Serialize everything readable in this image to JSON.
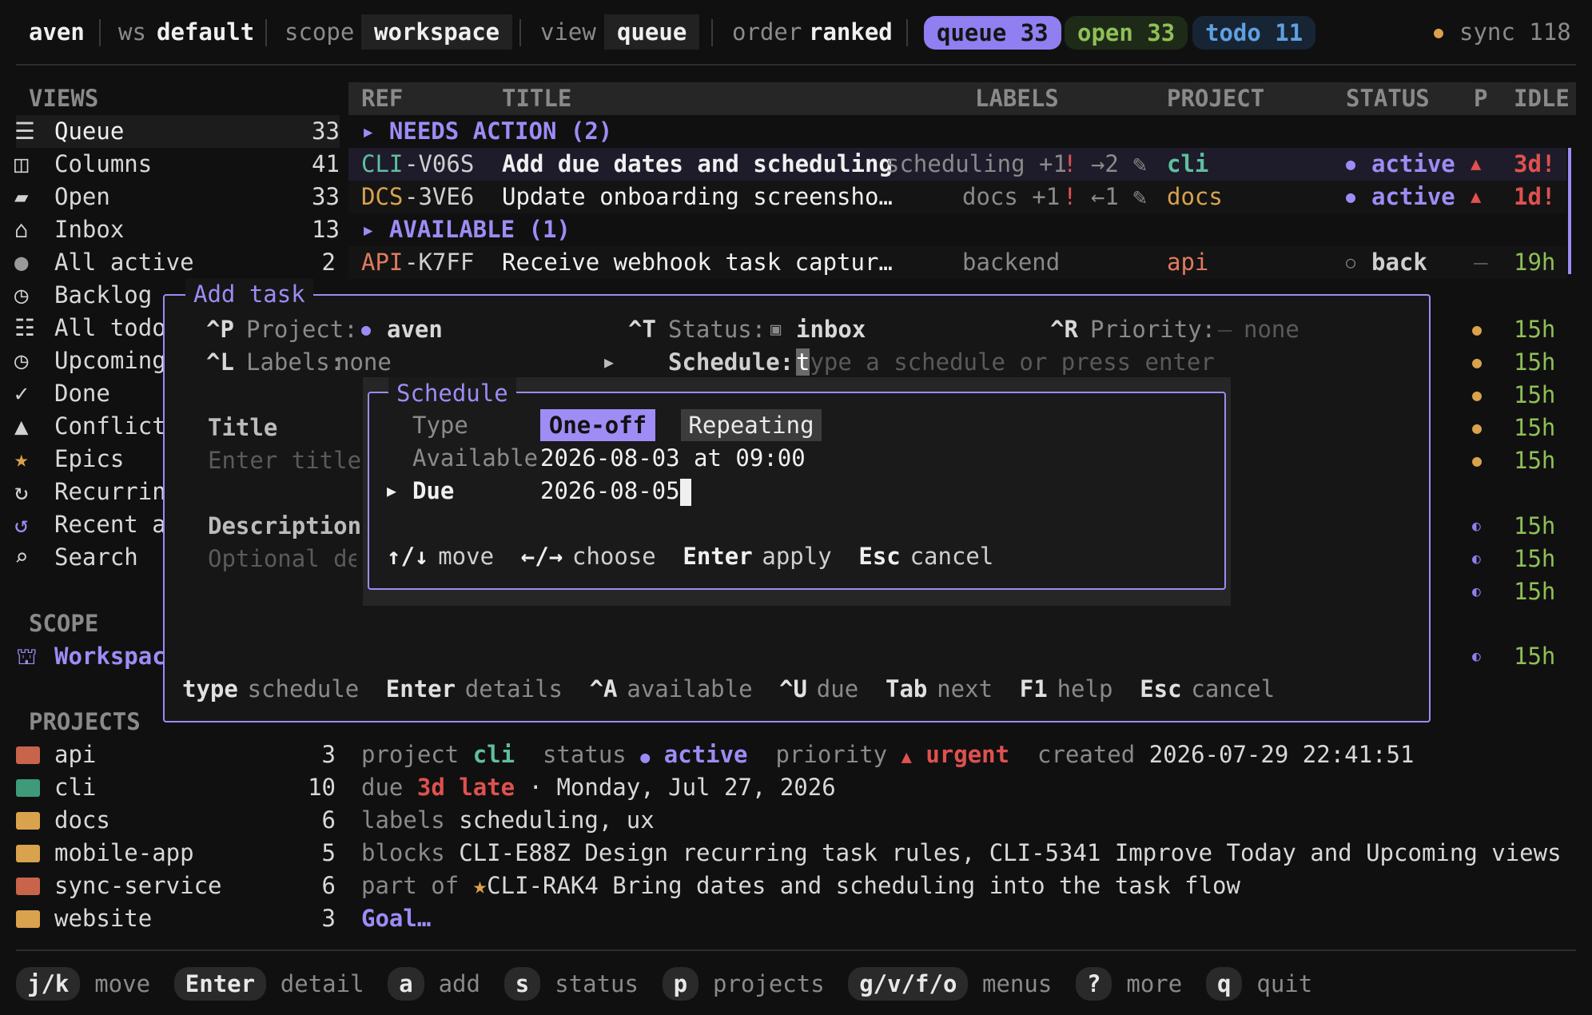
{
  "colors": {
    "accent": "#9d8cf5",
    "green": "#8fbf57",
    "orange": "#d9a24d",
    "red": "#e0514f",
    "teal": "#5fbf9f",
    "blue": "#5fa0e0",
    "salmon": "#e07a5f"
  },
  "topbar": {
    "user": "aven",
    "ws_label": "ws",
    "ws_value": "default",
    "scope_label": "scope",
    "scope_value": "workspace",
    "view_label": "view",
    "view_value": "queue",
    "order_label": "order",
    "order_value": "ranked",
    "queue_pill": "queue 33",
    "open_pill": "open 33",
    "todo_pill": "todo 11",
    "sync": "sync 118"
  },
  "sidebar": {
    "views_header": "VIEWS",
    "views": [
      {
        "icon": "list-icon",
        "label": "Queue",
        "count": "33"
      },
      {
        "icon": "columns-icon",
        "label": "Columns",
        "count": "41"
      },
      {
        "icon": "folder-open-icon",
        "label": "Open",
        "count": "33"
      },
      {
        "icon": "inbox-icon",
        "label": "Inbox",
        "count": "13"
      },
      {
        "icon": "circle-icon",
        "label": "All active",
        "count": "2"
      },
      {
        "icon": "clock-icon",
        "label": "Backlog",
        "count": ""
      },
      {
        "icon": "checklist-icon",
        "label": "All todo",
        "count": ""
      },
      {
        "icon": "clock-icon",
        "label": "Upcoming",
        "count": ""
      },
      {
        "icon": "check-icon",
        "label": "Done",
        "count": ""
      },
      {
        "icon": "warning-icon",
        "label": "Conflict",
        "count": ""
      },
      {
        "icon": "star-icon",
        "label": "Epics",
        "count": ""
      },
      {
        "icon": "repeat-icon",
        "label": "Recurrin",
        "count": ""
      },
      {
        "icon": "history-icon",
        "label": "Recent a",
        "count": ""
      },
      {
        "icon": "search-icon",
        "label": "Search",
        "count": ""
      }
    ],
    "scope_header": "SCOPE",
    "scope_item": "Workspac",
    "projects_header": "PROJECTS",
    "projects": [
      {
        "label": "api",
        "count": "3",
        "color": "#c8644a"
      },
      {
        "label": "cli",
        "count": "10",
        "color": "#3f9a7a"
      },
      {
        "label": "docs",
        "count": "6",
        "color": "#d9a24d"
      },
      {
        "label": "mobile-app",
        "count": "5",
        "color": "#d9a24d"
      },
      {
        "label": "sync-service",
        "count": "6",
        "color": "#c8644a"
      },
      {
        "label": "website",
        "count": "3",
        "color": "#d9a24d"
      }
    ]
  },
  "table": {
    "headers": {
      "ref": "REF",
      "title": "TITLE",
      "labels": "LABELS",
      "project": "PROJECT",
      "status": "STATUS",
      "p": "P",
      "idle": "IDLE"
    },
    "group1": "▸ NEEDS ACTION (2)",
    "group2": "▸ AVAILABLE (1)",
    "rows": [
      {
        "ref_prefix": "CLI",
        "ref_suffix": "-V06S",
        "title": "Add due dates and scheduling",
        "labels": "scheduling +1",
        "flags": "! →2 ✎",
        "project": "cli",
        "status": "active",
        "p": "▲",
        "idle": "3d!"
      },
      {
        "ref_prefix": "DCS",
        "ref_suffix": "-3VE6",
        "title": "Update onboarding screensho…",
        "labels": "docs +1",
        "flags": "! ←1 ✎",
        "project": "docs",
        "status": "active",
        "p": "▲",
        "idle": "1d!"
      },
      {
        "ref_prefix": "API",
        "ref_suffix": "-K7FF",
        "title": "Receive webhook task captur…",
        "labels": "backend",
        "flags": "",
        "project": "api",
        "status": "back",
        "p": "–",
        "idle": "19h"
      }
    ],
    "hidden_rows": [
      {
        "p": "●",
        "idle": "15h"
      },
      {
        "p": "●",
        "idle": "15h"
      },
      {
        "p": "●",
        "idle": "15h"
      },
      {
        "p": "●",
        "idle": "15h"
      },
      {
        "p": "●",
        "idle": "15h"
      },
      {
        "p": "◐",
        "idle": "15h"
      },
      {
        "p": "◐",
        "idle": "15h"
      },
      {
        "p": "◐",
        "idle": "15h"
      },
      {
        "p": "◐",
        "idle": "15h"
      }
    ]
  },
  "modal": {
    "title": "Add task",
    "project_key": "^P",
    "project_label": "Project:",
    "project_value": "aven",
    "status_key": "^T",
    "status_label": "Status:",
    "status_value": "inbox",
    "priority_key": "^R",
    "priority_label": "Priority:",
    "priority_value": "none",
    "labels_key": "^L",
    "labels_label": "Labels:",
    "labels_value": "none",
    "schedule_label": "Schedule:",
    "schedule_placeholder_first": "t",
    "schedule_placeholder_rest": "ype a schedule or press enter",
    "title_label": "Title",
    "title_placeholder": "Enter title",
    "desc_label": "Description",
    "desc_placeholder": "Optional det",
    "footer": [
      {
        "k": "type",
        "d": "schedule"
      },
      {
        "k": "Enter",
        "d": "details"
      },
      {
        "k": "^A",
        "d": "available"
      },
      {
        "k": "^U",
        "d": "due"
      },
      {
        "k": "Tab",
        "d": "next"
      },
      {
        "k": "F1",
        "d": "help"
      },
      {
        "k": "Esc",
        "d": "cancel"
      }
    ]
  },
  "schedule": {
    "title": "Schedule",
    "type_label": "Type",
    "one_off": "One-off",
    "repeating": "Repeating",
    "available_label": "Available",
    "available_value": "2026-08-03 at 09:00",
    "due_label": "Due",
    "due_value": "2026-08-05",
    "hints": [
      {
        "k": "↑/↓",
        "d": "move"
      },
      {
        "k": "←/→",
        "d": "choose"
      },
      {
        "k": "Enter",
        "d": "apply"
      },
      {
        "k": "Esc",
        "d": "cancel"
      }
    ]
  },
  "detail": {
    "l1": {
      "project_label": "project",
      "project": "cli",
      "status_label": "status",
      "status": "active",
      "priority_label": "priority",
      "priority": "urgent",
      "created_label": "created",
      "created": "2026-07-29 22:41:51"
    },
    "l2": {
      "due_label": "due",
      "late": "3d late",
      "date": "· Monday, Jul 27, 2026"
    },
    "l3": {
      "labels_label": "labels",
      "labels": "scheduling, ux"
    },
    "l4": {
      "blocks_label": "blocks",
      "blocks": "CLI-E88Z Design recurring task rules, CLI-5341 Improve Today and Upcoming views"
    },
    "l5": {
      "partof_label": "part of",
      "partof": "CLI-RAK4 Bring dates and scheduling into the task flow"
    },
    "l6": {
      "goal": "Goal…"
    }
  },
  "footer": [
    {
      "k": "j/k",
      "d": "move"
    },
    {
      "k": "Enter",
      "d": "detail"
    },
    {
      "k": "a",
      "d": "add"
    },
    {
      "k": "s",
      "d": "status"
    },
    {
      "k": "p",
      "d": "projects"
    },
    {
      "k": "g/v/f/o",
      "d": "menus"
    },
    {
      "k": "?",
      "d": "more"
    },
    {
      "k": "q",
      "d": "quit"
    }
  ]
}
